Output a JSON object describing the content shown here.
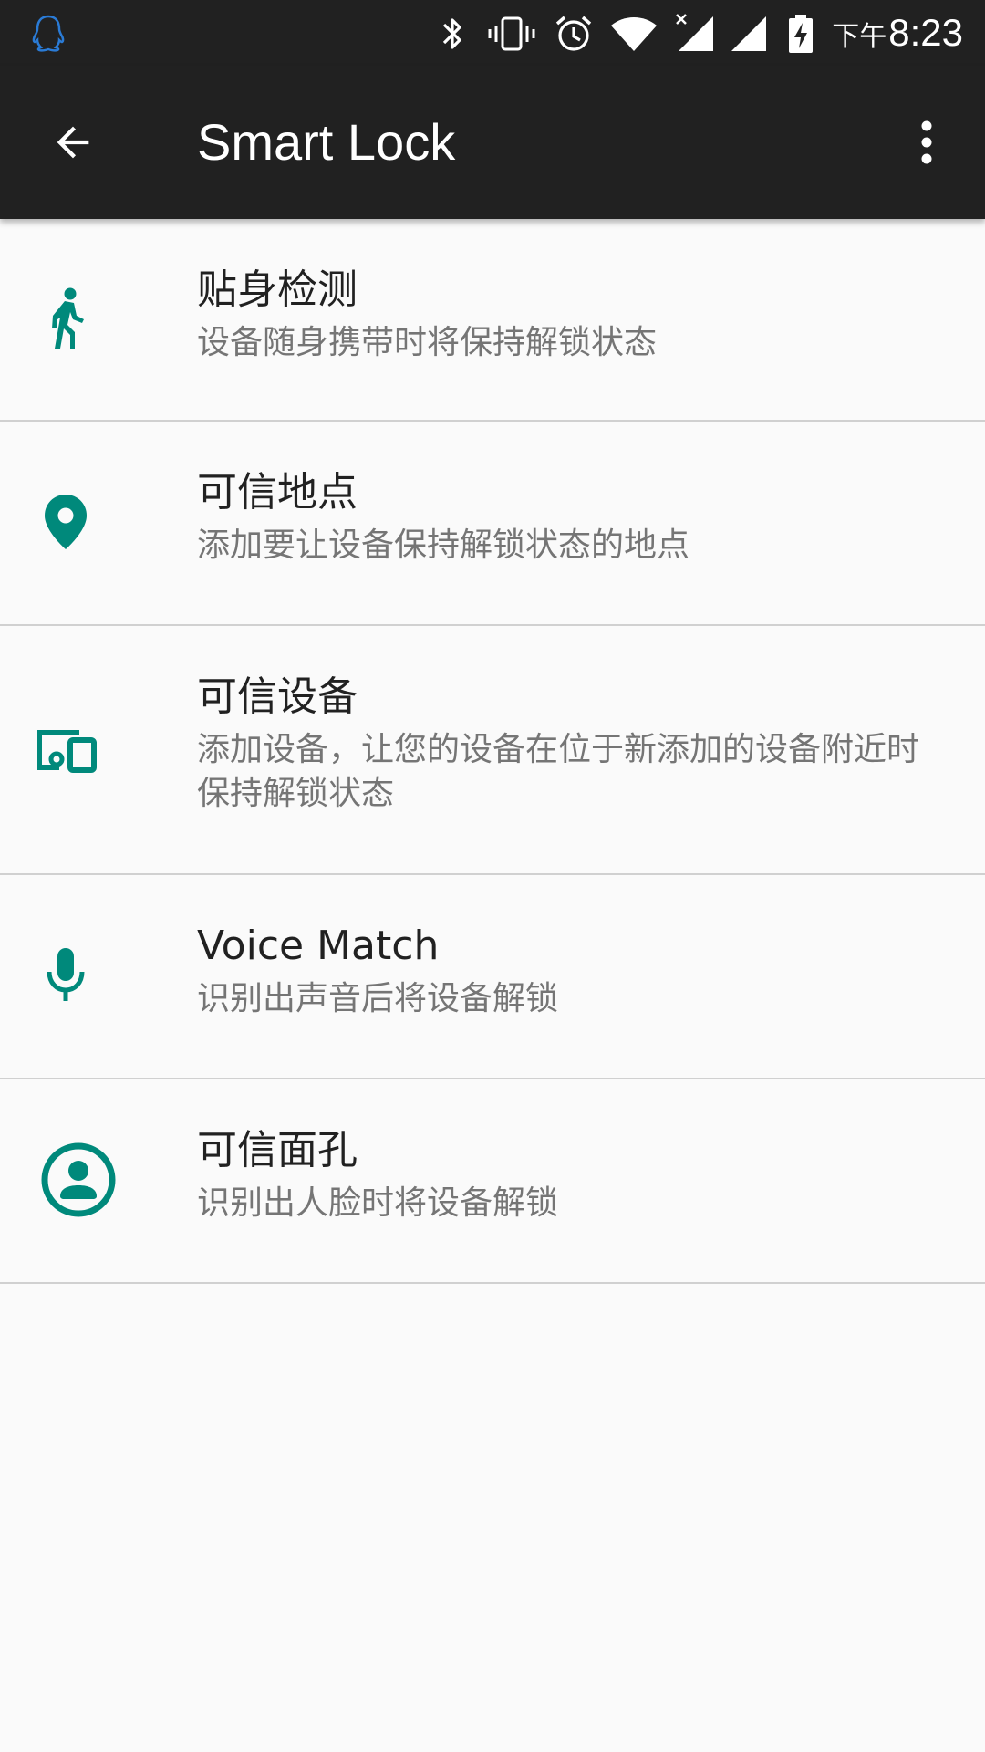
{
  "status_bar": {
    "time_period": "下午",
    "time": "8:23",
    "icons": [
      "qq-icon",
      "bluetooth-icon",
      "vibrate-icon",
      "alarm-icon",
      "wifi-icon",
      "signal-icon-sim1",
      "signal-icon-sim2",
      "battery-charging-icon"
    ]
  },
  "app_bar": {
    "title": "Smart Lock",
    "back_icon": "arrow-back-icon",
    "more_icon": "more-vert-icon"
  },
  "accent_color": "#00897b",
  "items": [
    {
      "title": "贴身检测",
      "subtitle": "设备随身携带时将保持解锁状态",
      "icon": "walking-person-icon"
    },
    {
      "title": "可信地点",
      "subtitle": "添加要让设备保持解锁状态的地点",
      "icon": "location-pin-icon"
    },
    {
      "title": "可信设备",
      "subtitle": "添加设备，让您的设备在位于新添加的设备附近时保持解锁状态",
      "icon": "devices-icon"
    },
    {
      "title": "Voice Match",
      "subtitle": "识别出声音后将设备解锁",
      "icon": "microphone-icon"
    },
    {
      "title": "可信面孔",
      "subtitle": "识别出人脸时将设备解锁",
      "icon": "face-icon"
    }
  ]
}
